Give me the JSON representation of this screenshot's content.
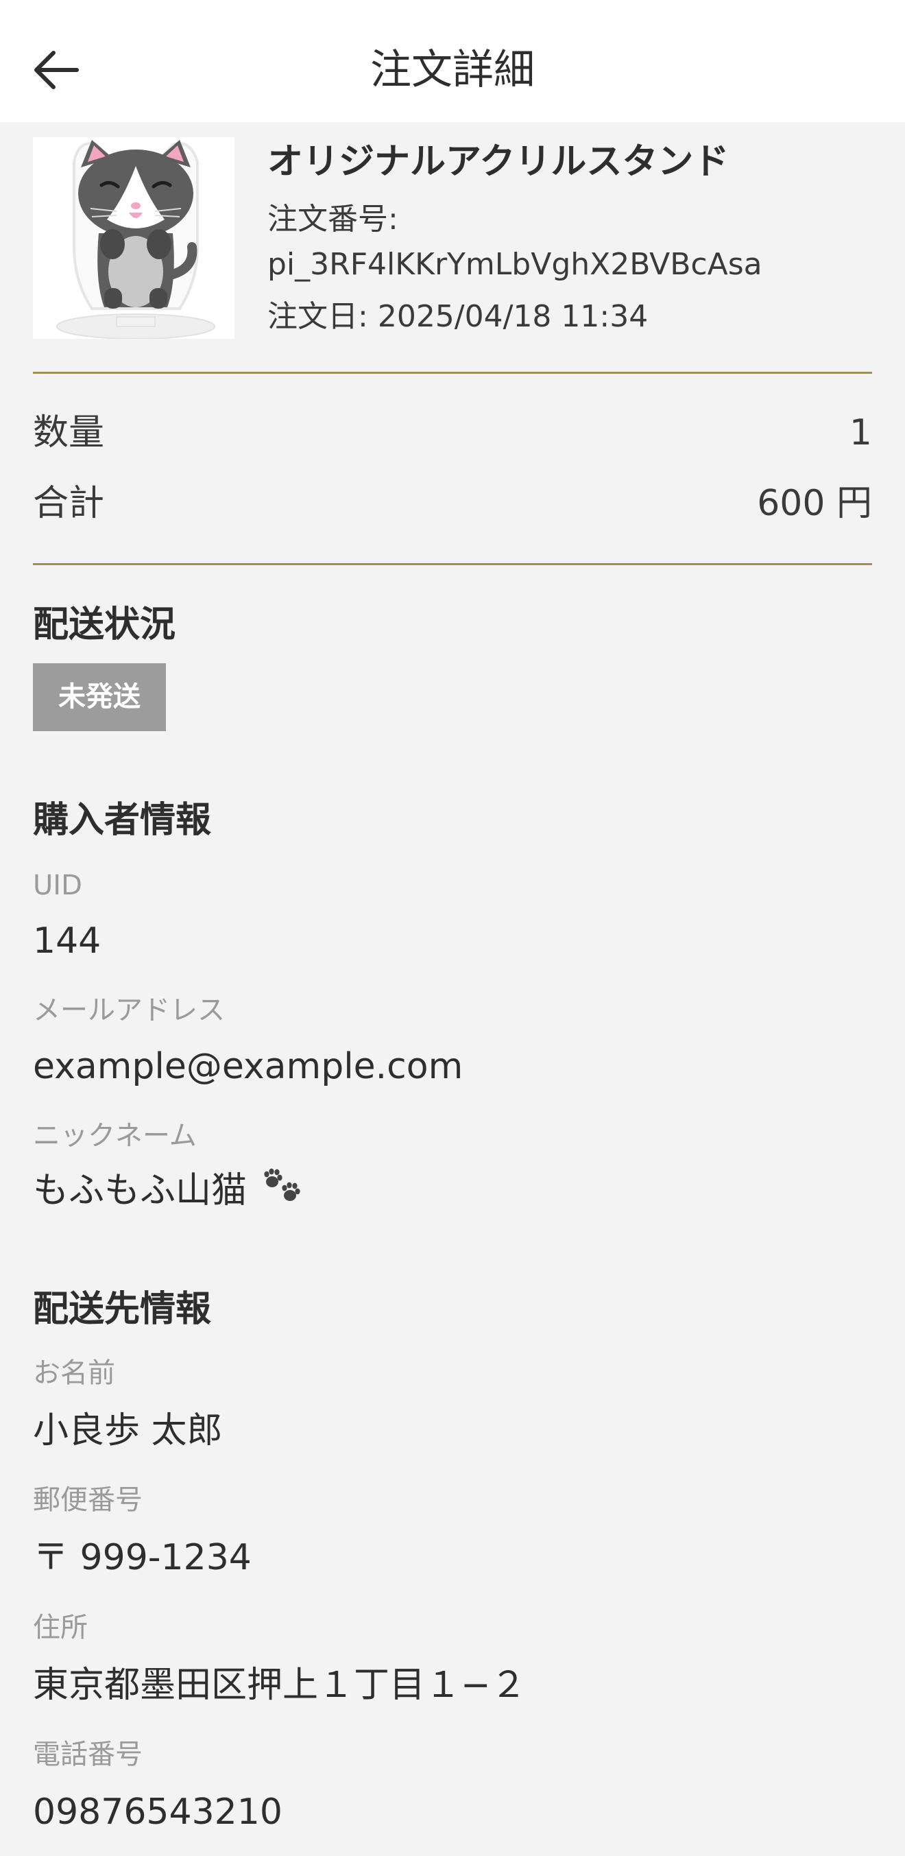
{
  "header": {
    "title": "注文詳細",
    "back_icon": "arrow-left-icon"
  },
  "product": {
    "name": "オリジナルアクリルスタンド",
    "order_number_label": "注文番号:",
    "order_number": "pi_3RF4lKKrYmLbVghX2BVBcAsa",
    "order_date_label": "注文日:",
    "order_date": "2025/04/18 11:34",
    "thumbnail_icon": "cat-acrylic-stand-image"
  },
  "summary": {
    "quantity_label": "数量",
    "quantity_value": "1",
    "total_label": "合計",
    "total_value": "600 円"
  },
  "shipping_status": {
    "title": "配送状況",
    "status": "未発送",
    "status_color": "#9c9c9c"
  },
  "buyer": {
    "title": "購入者情報",
    "uid_label": "UID",
    "uid": "144",
    "email_label": "メールアドレス",
    "email": "example@example.com",
    "nickname_label": "ニックネーム",
    "nickname": "もふもふ山猫",
    "nickname_icon": "paw-prints-icon"
  },
  "delivery": {
    "title": "配送先情報",
    "name_label": "お名前",
    "name": "小良歩 太郎",
    "postal_label": "郵便番号",
    "postal": "〒 999-1234",
    "address_label": "住所",
    "address": "東京都墨田区押上１丁目１−２",
    "phone_label": "電話番号",
    "phone": "09876543210"
  },
  "colors": {
    "accent_divider": "#a58c52",
    "background": "#f3f3f3",
    "header_bg": "#ffffff"
  }
}
